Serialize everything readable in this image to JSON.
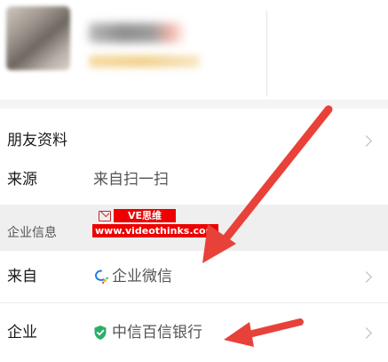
{
  "friend_profile": {
    "label": "朋友资料"
  },
  "source": {
    "label": "来源",
    "value": "来自扫一扫"
  },
  "enterprise_section": {
    "title": "企业信息"
  },
  "from_row": {
    "label": "来自",
    "value": "企业微信",
    "icon": "wecom-icon"
  },
  "company_row": {
    "label": "企业",
    "value": "中信百信银行",
    "icon": "verified-shield-icon"
  },
  "watermark": {
    "brand": "VE思维",
    "url": "www.videothinks.com"
  },
  "colors": {
    "arrow": "#e8413a",
    "verified": "#2aae67",
    "wecom_blue": "#1f7ce8",
    "wecom_yellow": "#f6b400",
    "watermark": "#e00000"
  }
}
